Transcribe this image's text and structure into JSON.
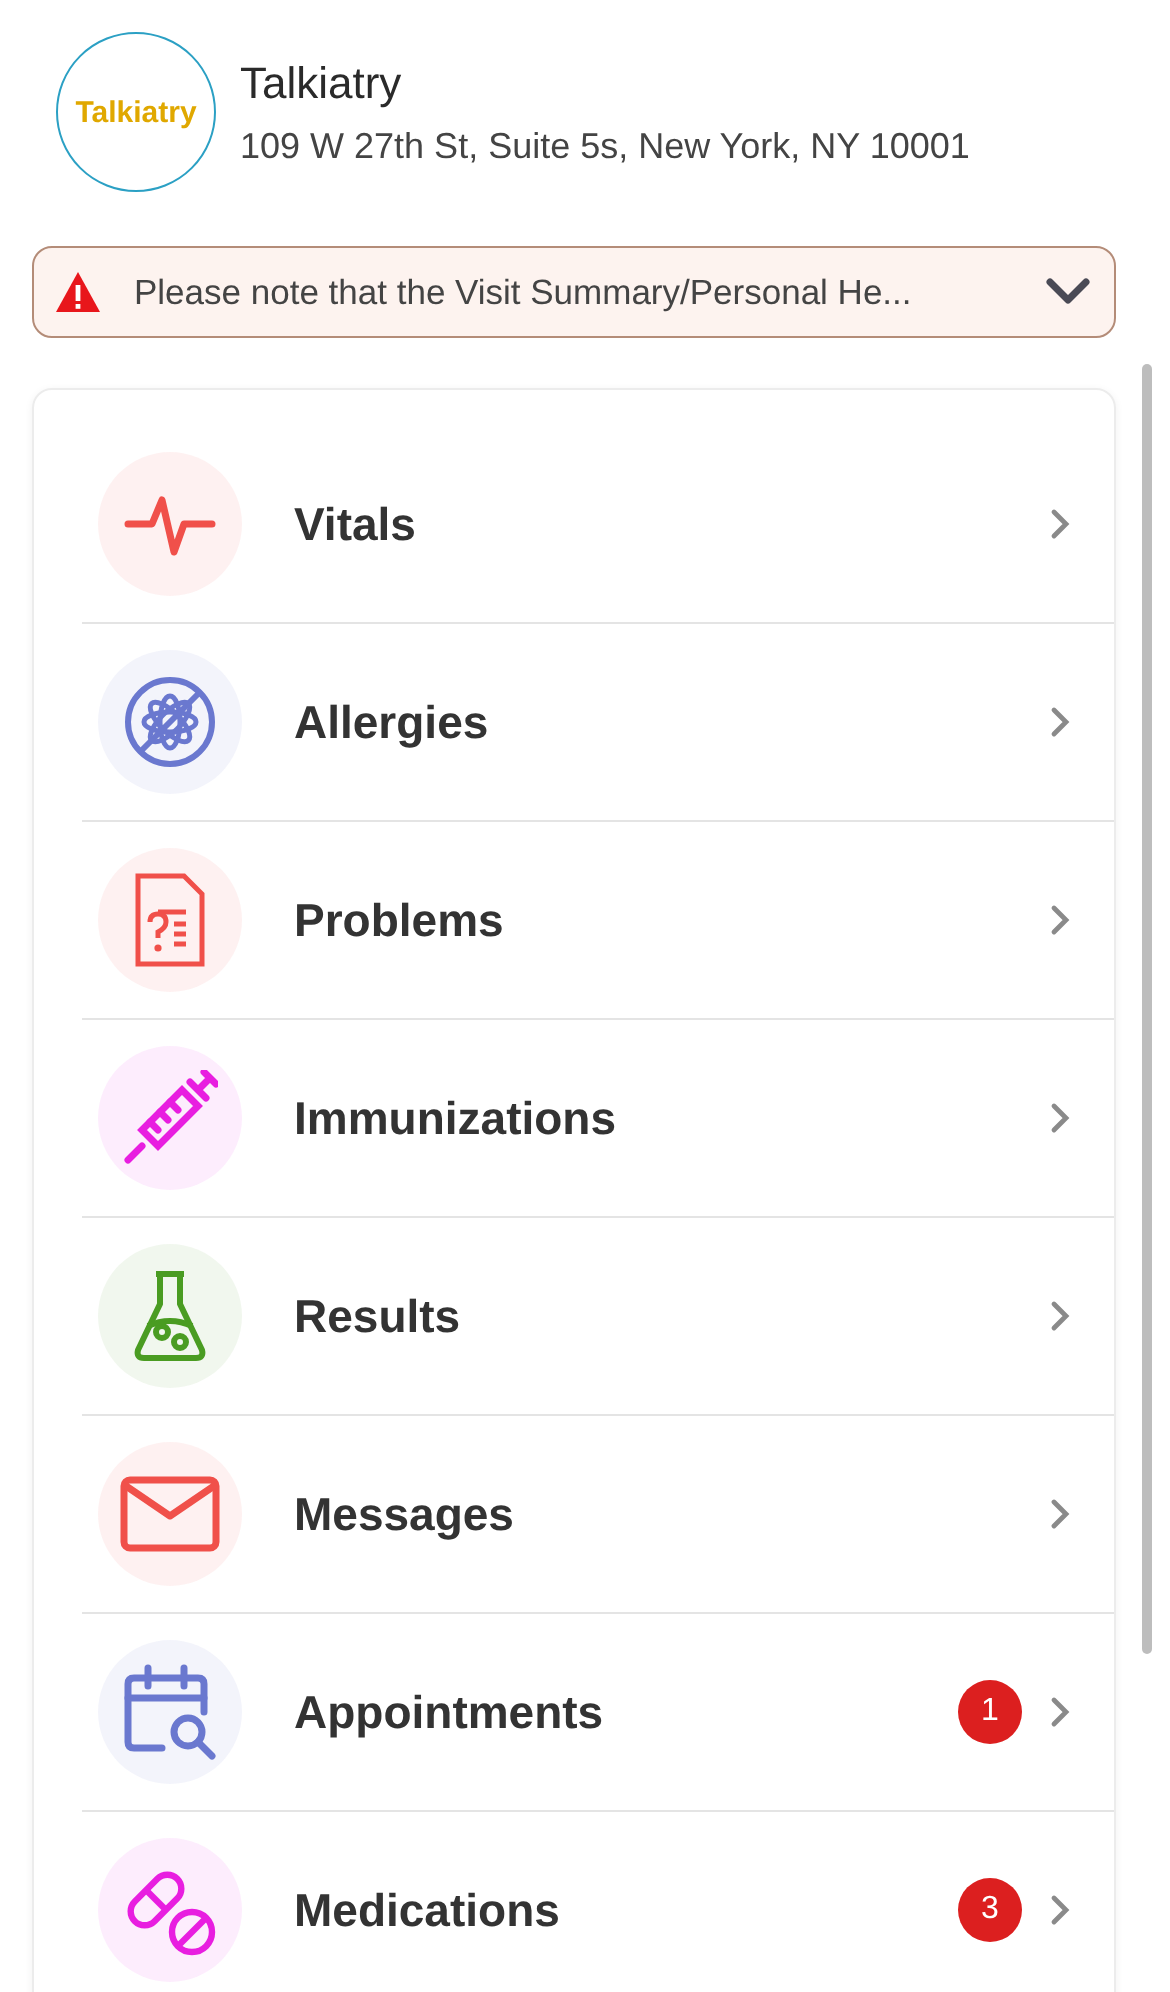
{
  "practice": {
    "logo_text": "Talkiatry",
    "name": "Talkiatry",
    "address": "109 W 27th St, Suite 5s, New York, NY 10001"
  },
  "notice": {
    "text": "Please note that the Visit Summary/Personal He...",
    "expanded": false
  },
  "menu": [
    {
      "label": "Vitals",
      "kind": "pulse",
      "color": "#f0504a"
    },
    {
      "label": "Allergies",
      "kind": "allergy",
      "color": "#6a78cf"
    },
    {
      "label": "Problems",
      "kind": "document",
      "color": "#f0504a"
    },
    {
      "label": "Immunizations",
      "kind": "syringe",
      "color": "#e81ee0"
    },
    {
      "label": "Results",
      "kind": "flask",
      "color": "#4a9c22"
    },
    {
      "label": "Messages",
      "kind": "mail",
      "color": "#f0504a"
    },
    {
      "label": "Appointments",
      "kind": "calendar",
      "color": "#6a78cf",
      "badge": "1"
    },
    {
      "label": "Medications",
      "kind": "pills",
      "color": "#e81ee0",
      "badge": "3"
    }
  ]
}
